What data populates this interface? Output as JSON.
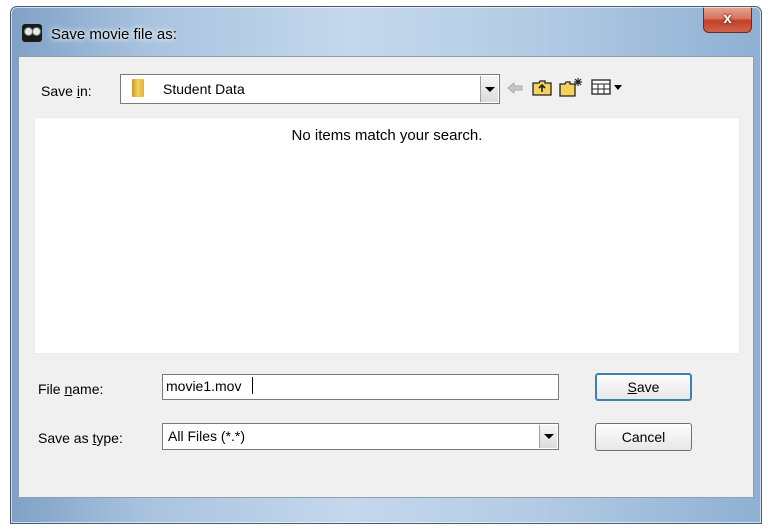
{
  "window": {
    "title": "Save movie file as:",
    "close_label": "x"
  },
  "toolbar": {
    "save_in_label_pre": "Save ",
    "save_in_label_mnemonic": "i",
    "save_in_label_post": "n:",
    "location": "Student Data",
    "icons": [
      "back-arrow-icon",
      "up-folder-icon",
      "new-folder-icon",
      "view-menu-icon"
    ]
  },
  "file_list": {
    "empty_message": "No items match your search."
  },
  "form": {
    "file_name_label_pre": "File ",
    "file_name_label_mnemonic": "n",
    "file_name_label_post": "ame:",
    "file_name_value": "movie1.mov",
    "save_type_label_pre": "Save as ",
    "save_type_label_mnemonic": "t",
    "save_type_label_post": "ype:",
    "save_type_value": "All Files (*.*)"
  },
  "buttons": {
    "save_mnemonic": "S",
    "save_rest": "ave",
    "cancel": "Cancel"
  }
}
